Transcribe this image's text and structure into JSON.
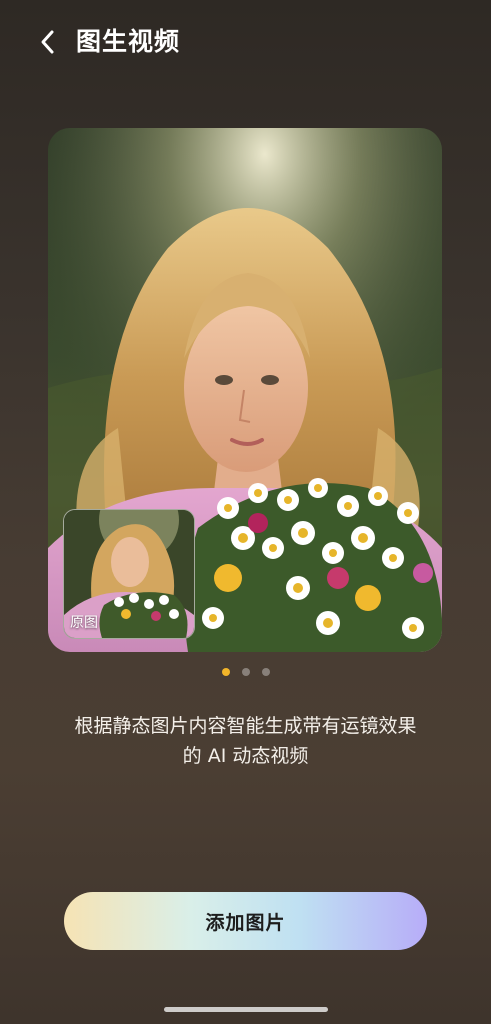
{
  "header": {
    "title": "图生视频",
    "back_icon": "chevron-left-icon"
  },
  "preview": {
    "original_label": "原图",
    "page_indicator": {
      "total": 3,
      "active_index": 0,
      "active_color": "#f2b52a"
    }
  },
  "description": {
    "line1": "根据静态图片内容智能生成带有运镜效果",
    "line2": "的 AI 动态视频"
  },
  "actions": {
    "add_image_label": "添加图片"
  },
  "colors": {
    "background": "#3e342c",
    "button_gradient": [
      "#f6e3b4",
      "#d9efe9",
      "#bfe0f2",
      "#b7adf8"
    ]
  }
}
